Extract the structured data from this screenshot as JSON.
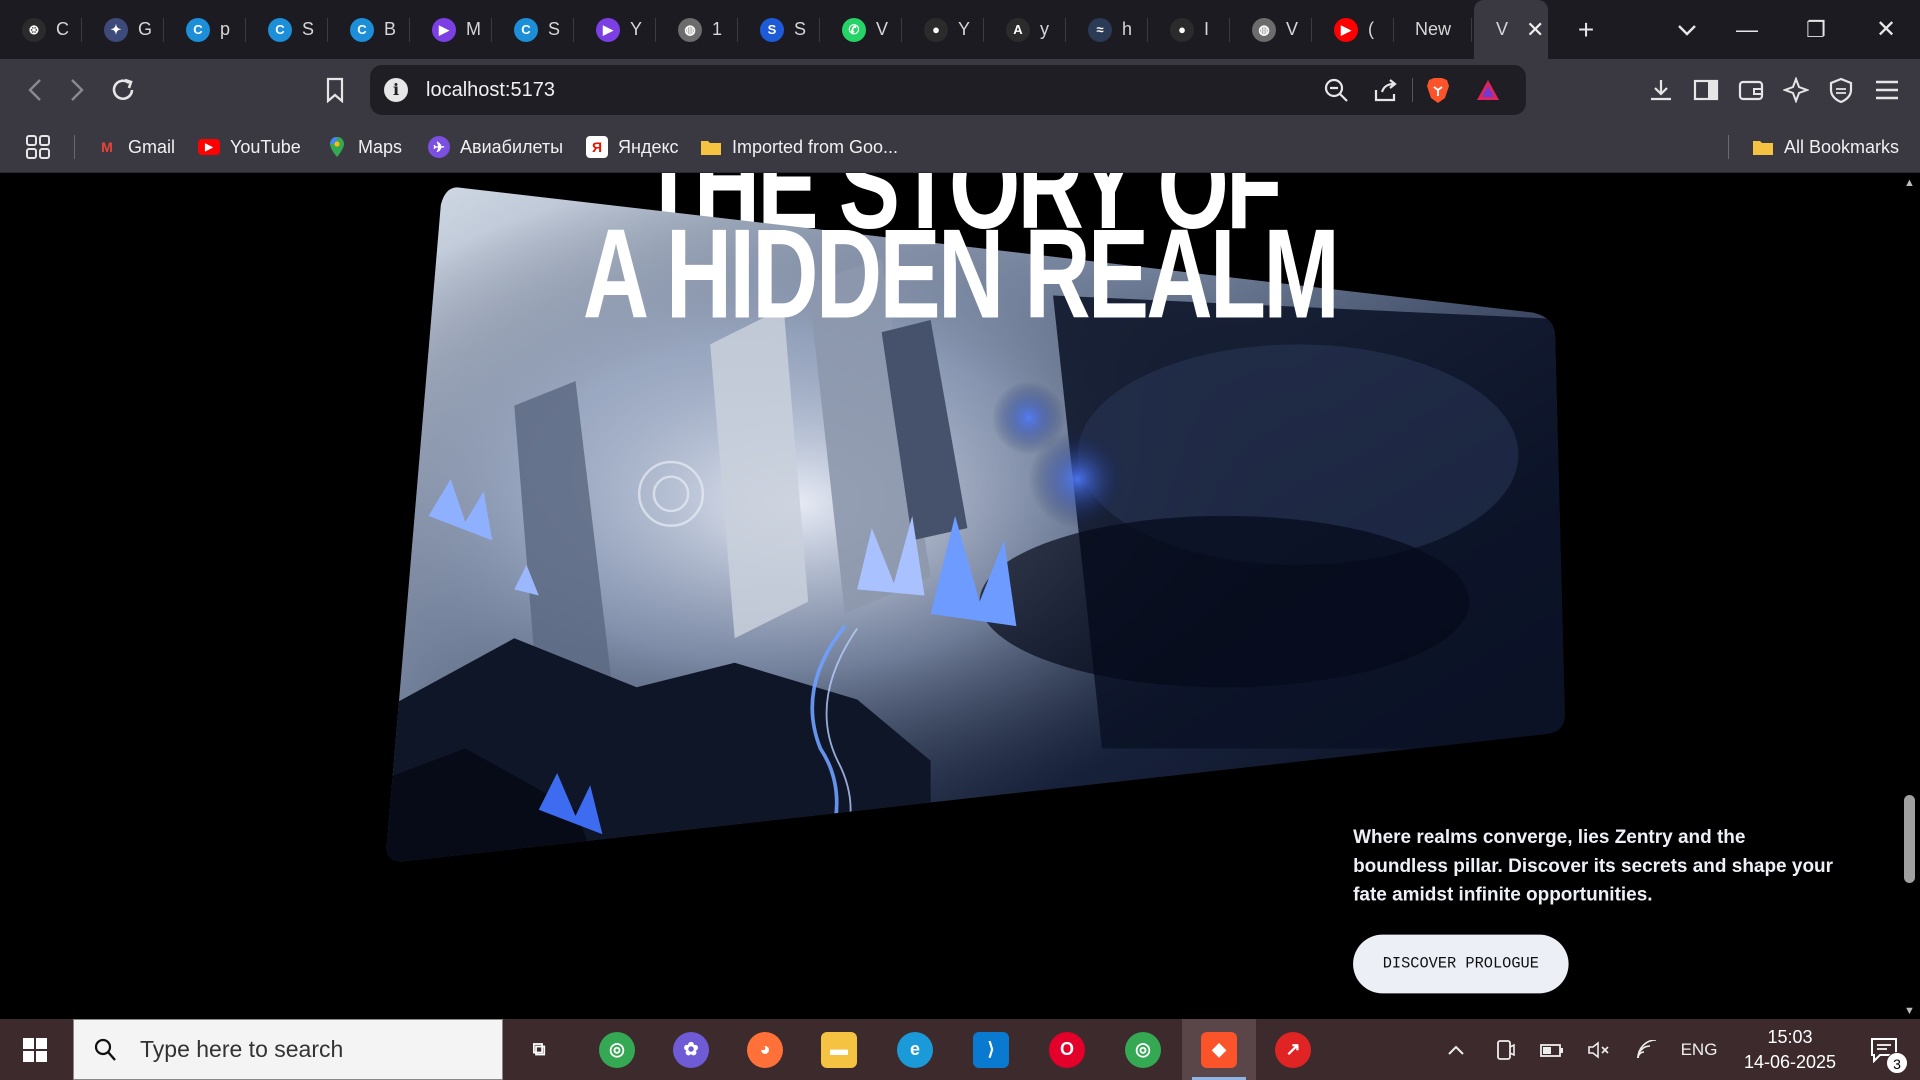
{
  "browser": {
    "tabs": [
      {
        "title": "C",
        "icon": "openai-icon",
        "color": "#2b2b2b",
        "glyph": "⊛"
      },
      {
        "title": "G",
        "icon": "gemini-icon",
        "color": "#3d4a7a",
        "glyph": "✦"
      },
      {
        "title": "p",
        "icon": "canva-icon",
        "color": "#1d8fd8",
        "glyph": "C"
      },
      {
        "title": "S",
        "icon": "canva-icon",
        "color": "#1d8fd8",
        "glyph": "C"
      },
      {
        "title": "B",
        "icon": "canva-icon",
        "color": "#1d8fd8",
        "glyph": "C"
      },
      {
        "title": "M",
        "icon": "video-icon",
        "color": "#7b3fe4",
        "glyph": "▶"
      },
      {
        "title": "S",
        "icon": "canva-icon",
        "color": "#1d8fd8",
        "glyph": "C"
      },
      {
        "title": "Y",
        "icon": "video-icon",
        "color": "#7b3fe4",
        "glyph": "▶"
      },
      {
        "title": "1",
        "icon": "globe-icon",
        "color": "#6c6c6c",
        "glyph": "◍"
      },
      {
        "title": "S",
        "icon": "s-logo-icon",
        "color": "#1e5bd8",
        "glyph": "S"
      },
      {
        "title": "V",
        "icon": "whatsapp-icon",
        "color": "#25d366",
        "glyph": "✆"
      },
      {
        "title": "Y",
        "icon": "github-icon",
        "color": "#2b2b2b",
        "glyph": "●"
      },
      {
        "title": "y",
        "icon": "ai-logo-icon",
        "color": "#2b2b2b",
        "glyph": "A"
      },
      {
        "title": "h",
        "icon": "tailwind-icon",
        "color": "#2b3a55",
        "glyph": "≈"
      },
      {
        "title": "I",
        "icon": "github-icon",
        "color": "#2b2b2b",
        "glyph": "●"
      },
      {
        "title": "V",
        "icon": "globe-icon",
        "color": "#6c6c6c",
        "glyph": "◍"
      },
      {
        "title": "(",
        "icon": "youtube-icon",
        "color": "#ff0000",
        "glyph": "▶"
      }
    ],
    "new_tab_title": "New",
    "active_tab_title": "V",
    "active_tab_close": "✕",
    "new_tab_button": "+",
    "tab_list_button": "⌄",
    "minimize": "—",
    "restore": "❐",
    "close": "✕",
    "url": "localhost:5173",
    "info_glyph": "i"
  },
  "bookmarks": {
    "apps_label": "",
    "items": [
      {
        "label": "Gmail",
        "icon": "gmail-icon",
        "color": "#ea4335",
        "glyph": "M"
      },
      {
        "label": "YouTube",
        "icon": "youtube-icon",
        "color": "#ff0000",
        "glyph": "▶"
      },
      {
        "label": "Maps",
        "icon": "maps-pin-icon",
        "color": "#34a853",
        "glyph": "⬤"
      },
      {
        "label": "Авиабилеты",
        "icon": "aviasales-icon",
        "color": "#7b4fe0",
        "glyph": "✈"
      },
      {
        "label": "Яндекс",
        "icon": "yandex-icon",
        "color": "#ffffff",
        "glyph": "Я"
      },
      {
        "label": "Imported from Goo...",
        "icon": "folder-icon",
        "color": "#f5c242",
        "glyph": ""
      }
    ],
    "all_bookmarks": "All Bookmarks"
  },
  "page": {
    "title_line1": "THE STORY OF",
    "title_line2": "A HIDDEN REALM",
    "description": "Where realms converge, lies Zentry and the boundless pillar. Discover its secrets and shape your fate amidst infinite opportunities.",
    "cta": "DISCOVER PROLOGUE"
  },
  "taskbar": {
    "search_placeholder": "Type here to search",
    "apps": [
      {
        "name": "task-view",
        "color": "transparent",
        "glyph": "⧉"
      },
      {
        "name": "chrome",
        "color": "#34a853",
        "glyph": "◎"
      },
      {
        "name": "copilot",
        "color": "#6f5bd6",
        "glyph": "✿"
      },
      {
        "name": "firefox",
        "color": "#ff7139",
        "glyph": "◕"
      },
      {
        "name": "file-explorer",
        "color": "#f5c242",
        "glyph": "▬"
      },
      {
        "name": "edge",
        "color": "#1a9ad8",
        "glyph": "e"
      },
      {
        "name": "vscode",
        "color": "#0a7ad0",
        "glyph": "⟩"
      },
      {
        "name": "opera",
        "color": "#e3002b",
        "glyph": "O"
      },
      {
        "name": "chrome-profile",
        "color": "#34a853",
        "glyph": "◎"
      },
      {
        "name": "brave",
        "color": "#fb542b",
        "glyph": "◆"
      },
      {
        "name": "app-red",
        "color": "#e02424",
        "glyph": "↗"
      }
    ],
    "language": "ENG",
    "time": "15:03",
    "date": "14-06-2025",
    "notification_count": "3"
  }
}
